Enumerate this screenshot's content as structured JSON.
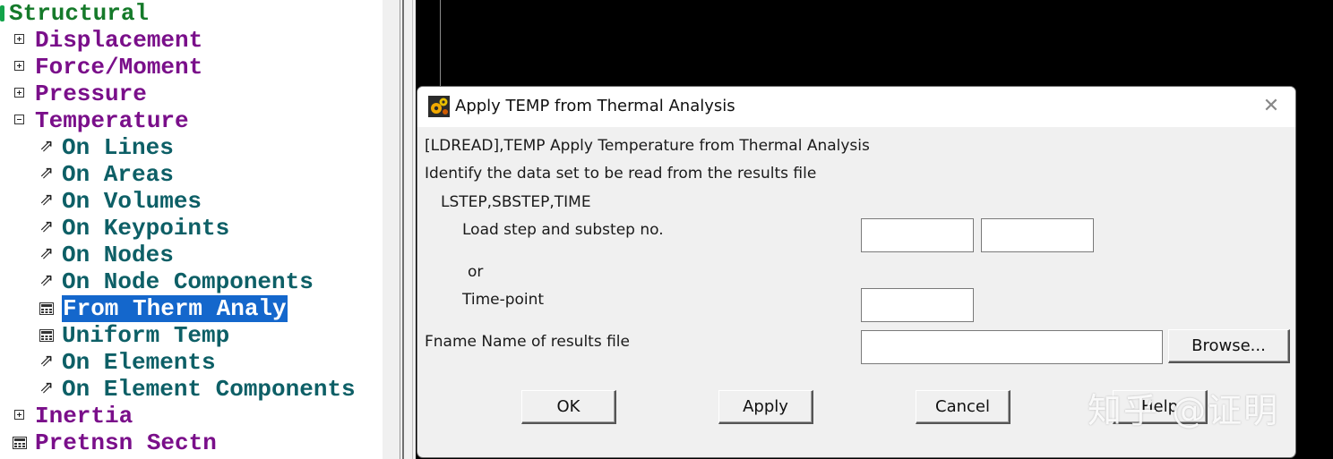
{
  "tree": {
    "root_label": "Structural",
    "items": [
      {
        "label": "Displacement",
        "kind": "expander",
        "state": "collapsed"
      },
      {
        "label": "Force/Moment",
        "kind": "expander",
        "state": "collapsed"
      },
      {
        "label": "Pressure",
        "kind": "expander",
        "state": "collapsed"
      },
      {
        "label": "Temperature",
        "kind": "expander",
        "state": "expanded"
      },
      {
        "label": "On Lines",
        "kind": "pick"
      },
      {
        "label": "On Areas",
        "kind": "pick"
      },
      {
        "label": "On Volumes",
        "kind": "pick"
      },
      {
        "label": "On Keypoints",
        "kind": "pick"
      },
      {
        "label": "On Nodes",
        "kind": "pick"
      },
      {
        "label": "On Node Components",
        "kind": "pick"
      },
      {
        "label": "From Therm Analy",
        "kind": "dialog",
        "selected": true
      },
      {
        "label": "Uniform Temp",
        "kind": "dialog"
      },
      {
        "label": "On Elements",
        "kind": "pick"
      },
      {
        "label": "On Element Components",
        "kind": "pick"
      },
      {
        "label": "Inertia",
        "kind": "expander",
        "state": "collapsed"
      },
      {
        "label": "Pretnsn Sectn",
        "kind": "dialog"
      }
    ]
  },
  "dialog": {
    "title": "Apply TEMP from Thermal Analysis",
    "command_line": "[LDREAD],TEMP  Apply Temperature from Thermal Analysis",
    "identify_text": "Identify the data set to be read from the results file",
    "lstep_label": "LSTEP,SBSTEP,TIME",
    "load_step_label": "Load step and substep no.",
    "or_label": "or",
    "time_point_label": "Time-point",
    "fname_label": "Fname  Name of results file",
    "load_step_value": "",
    "substep_value": "",
    "time_point_value": "",
    "fname_value": "",
    "buttons": {
      "browse": "Browse...",
      "ok": "OK",
      "apply": "Apply",
      "cancel": "Cancel",
      "help": "Help"
    }
  },
  "watermark": "知乎 @证明",
  "colors": {
    "tree_purple": "#7a0f8a",
    "tree_teal": "#0d5f66",
    "tree_green": "#157a2a",
    "selection_blue": "#1467cc",
    "graphics_bg": "#000000",
    "dialog_bg": "#f0f0f0"
  },
  "icons": {
    "expand": "plus-box-icon",
    "collapse": "minus-box-icon",
    "pick": "pick-arrow-icon",
    "dialog": "calculator-icon",
    "app": "ansys-gear-icon",
    "close": "close-icon"
  }
}
